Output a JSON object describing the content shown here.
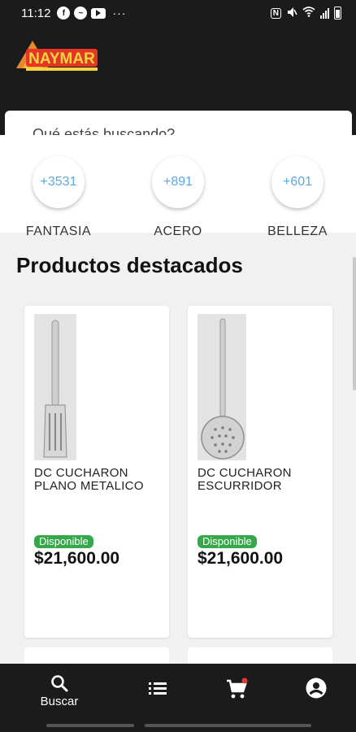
{
  "status_bar": {
    "time": "11:12",
    "dots": "···",
    "left_icons": [
      "facebook-icon",
      "messenger-icon",
      "youtube-icon"
    ],
    "right_icons": [
      "nfc-icon",
      "mute-icon",
      "wifi-icon",
      "signal-icon",
      "battery-icon"
    ]
  },
  "header": {
    "logo_text": "NAYMAR",
    "search": {
      "placeholder": "Qué estás buscando?"
    }
  },
  "categories": [
    {
      "count": "+3531",
      "label": "FANTASIA"
    },
    {
      "count": "+891",
      "label": "ACERO"
    },
    {
      "count": "+601",
      "label": "BELLEZA"
    }
  ],
  "section_title": "Productos destacados",
  "products": [
    {
      "name": "DC CUCHARON PLANO METALICO",
      "badge": "Disponible",
      "price": "$21,600.00",
      "image": "slotted-spatula"
    },
    {
      "name": "DC CUCHARON ESCURRIDOR",
      "badge": "Disponible",
      "price": "$21,600.00",
      "image": "skimmer-ladle"
    }
  ],
  "bottom_nav": [
    {
      "icon": "search-icon",
      "label": "Buscar"
    },
    {
      "icon": "list-icon",
      "label": ""
    },
    {
      "icon": "cart-icon",
      "label": ""
    },
    {
      "icon": "account-icon",
      "label": ""
    }
  ],
  "colors": {
    "header_bg": "#1b1b1b",
    "badge_green": "#37a84a",
    "category_count_blue": "#5aa9e6",
    "cart_dot_red": "#e53935"
  }
}
